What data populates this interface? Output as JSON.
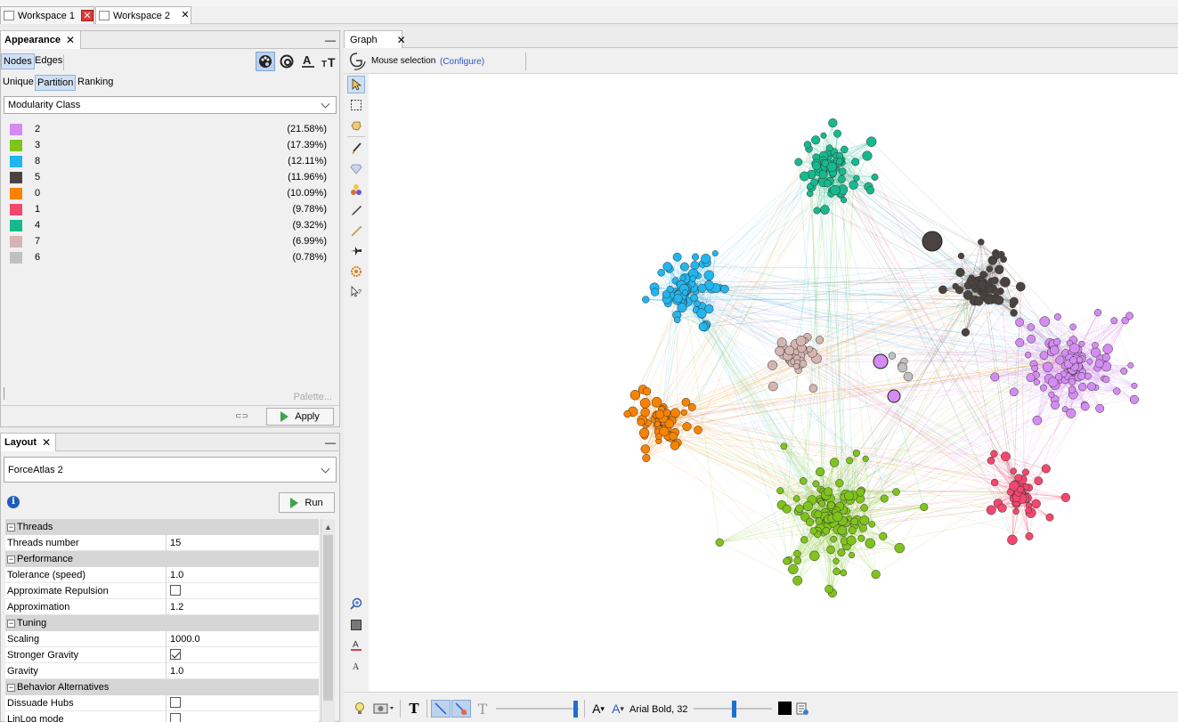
{
  "workspace_tabs": [
    {
      "label": "Workspace 1",
      "active": false
    },
    {
      "label": "Workspace 2",
      "active": true
    }
  ],
  "appearance": {
    "title": "Appearance",
    "element_tabs": [
      "Nodes",
      "Edges"
    ],
    "modes": [
      "Unique",
      "Partition",
      "Ranking"
    ],
    "attribute": "Modularity Class",
    "legend": [
      {
        "label": "2",
        "pct": "(21.58%)",
        "color": "#d58cf2"
      },
      {
        "label": "3",
        "pct": "(17.39%)",
        "color": "#7fc31c"
      },
      {
        "label": "8",
        "pct": "(12.11%)",
        "color": "#21b6ef"
      },
      {
        "label": "5",
        "pct": "(11.96%)",
        "color": "#4a4340"
      },
      {
        "label": "0",
        "pct": "(10.09%)",
        "color": "#f98200"
      },
      {
        "label": "1",
        "pct": "(9.78%)",
        "color": "#f2476e"
      },
      {
        "label": "4",
        "pct": "(9.32%)",
        "color": "#16b98c"
      },
      {
        "label": "7",
        "pct": "(6.99%)",
        "color": "#d4b5b1"
      },
      {
        "label": "6",
        "pct": "(0.78%)",
        "color": "#c0c0c0"
      }
    ],
    "palette_link": "Palette...",
    "apply_label": "Apply"
  },
  "layout": {
    "title": "Layout",
    "algorithm": "ForceAtlas 2",
    "run_label": "Run",
    "sections": [
      {
        "name": "Threads",
        "rows": [
          {
            "key": "Threads number",
            "value": "15"
          }
        ]
      },
      {
        "name": "Performance",
        "rows": [
          {
            "key": "Tolerance (speed)",
            "value": "1.0"
          },
          {
            "key": "Approximate Repulsion",
            "checkbox": false
          },
          {
            "key": "Approximation",
            "value": "1.2"
          }
        ]
      },
      {
        "name": "Tuning",
        "rows": [
          {
            "key": "Scaling",
            "value": "1000.0"
          },
          {
            "key": "Stronger Gravity",
            "checkbox": true
          },
          {
            "key": "Gravity",
            "value": "1.0"
          }
        ]
      },
      {
        "name": "Behavior Alternatives",
        "rows": [
          {
            "key": "Dissuade Hubs",
            "checkbox": false
          },
          {
            "key": "LinLog mode",
            "checkbox": false
          }
        ]
      }
    ]
  },
  "graph": {
    "tab_label": "Graph",
    "mode_label": "Mouse selection",
    "configure_link": "(Configure)",
    "font_label": "Arial Bold, 32"
  }
}
